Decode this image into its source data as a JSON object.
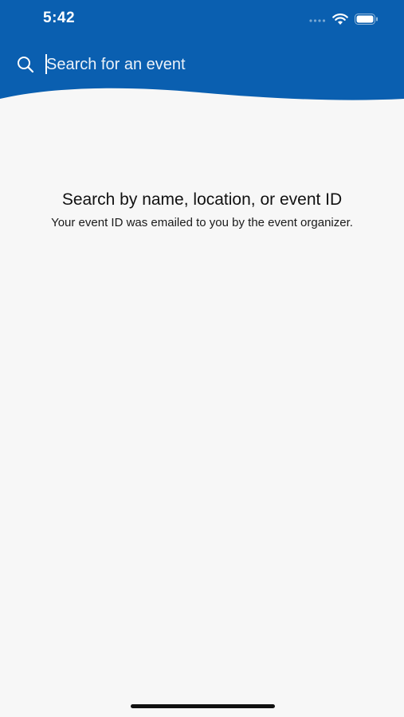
{
  "status_bar": {
    "time": "5:42",
    "icons": [
      "cellular-icon",
      "wifi-icon",
      "battery-icon"
    ]
  },
  "search": {
    "placeholder": "Search for an event",
    "value": ""
  },
  "empty_state": {
    "title": "Search by name, location, or event ID",
    "subtitle": "Your event ID was emailed to you by the event organizer."
  },
  "colors": {
    "header": "#0a5fb0",
    "background": "#f7f7f7",
    "text": "#111111"
  }
}
